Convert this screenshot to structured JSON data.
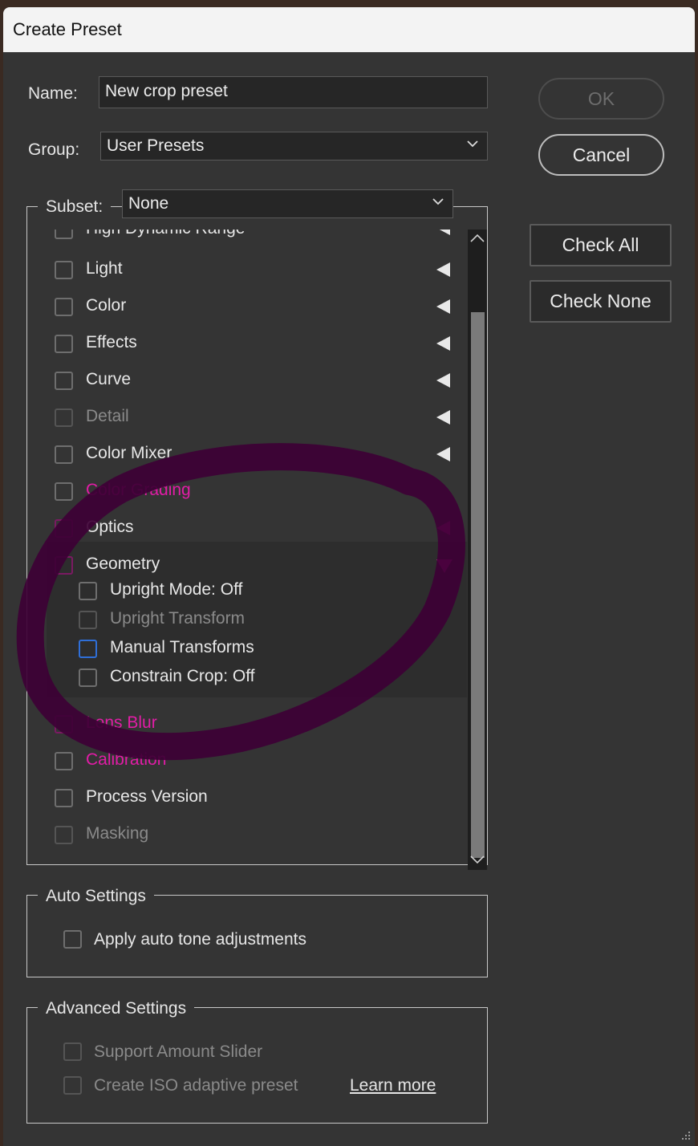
{
  "window": {
    "title": "Create Preset"
  },
  "form": {
    "name_label": "Name:",
    "name_value": "New crop preset",
    "group_label": "Group:",
    "group_value": "User Presets",
    "subset_label": "Subset:",
    "subset_value": "None"
  },
  "buttons": {
    "ok": "OK",
    "cancel": "Cancel",
    "check_all": "Check All",
    "check_none": "Check None"
  },
  "settings_list": {
    "partial_top": "High Dynamic Range",
    "items": [
      {
        "label": "Light",
        "checked": false,
        "state": "collapsed"
      },
      {
        "label": "Color",
        "checked": false,
        "state": "collapsed"
      },
      {
        "label": "Effects",
        "checked": false,
        "state": "collapsed"
      },
      {
        "label": "Curve",
        "checked": false,
        "state": "collapsed"
      },
      {
        "label": "Detail",
        "checked": false,
        "disabled": true,
        "state": "collapsed"
      },
      {
        "label": "Color Mixer",
        "checked": false,
        "state": "collapsed"
      },
      {
        "label": "Color Grading",
        "checked": false
      },
      {
        "label": "Optics",
        "checked": false,
        "state": "collapsed"
      },
      {
        "label": "Geometry",
        "checked": false,
        "state": "expanded"
      },
      {
        "label": "Lens Blur",
        "checked": false
      },
      {
        "label": "Calibration",
        "checked": false
      },
      {
        "label": "Process Version",
        "checked": false
      },
      {
        "label": "Masking",
        "checked": false,
        "disabled": true
      }
    ],
    "geometry_children": [
      {
        "label": "Upright Mode: Off",
        "checked": false
      },
      {
        "label": "Upright Transform",
        "checked": false,
        "disabled": true
      },
      {
        "label": "Manual Transforms",
        "checked": false,
        "focused": true
      },
      {
        "label": "Constrain Crop: Off",
        "checked": false
      }
    ]
  },
  "auto_settings": {
    "title": "Auto Settings",
    "apply_auto_tone": "Apply auto tone adjustments"
  },
  "advanced_settings": {
    "title": "Advanced Settings",
    "support_amount_slider": "Support Amount Slider",
    "create_iso_adaptive": "Create ISO adaptive preset",
    "learn_more": "Learn more"
  },
  "colors": {
    "dialog_bg": "#343434",
    "annotation_stroke": "#3d0035",
    "annotation_text": "#e21ca7",
    "focus_blue": "#2f6fd8"
  }
}
